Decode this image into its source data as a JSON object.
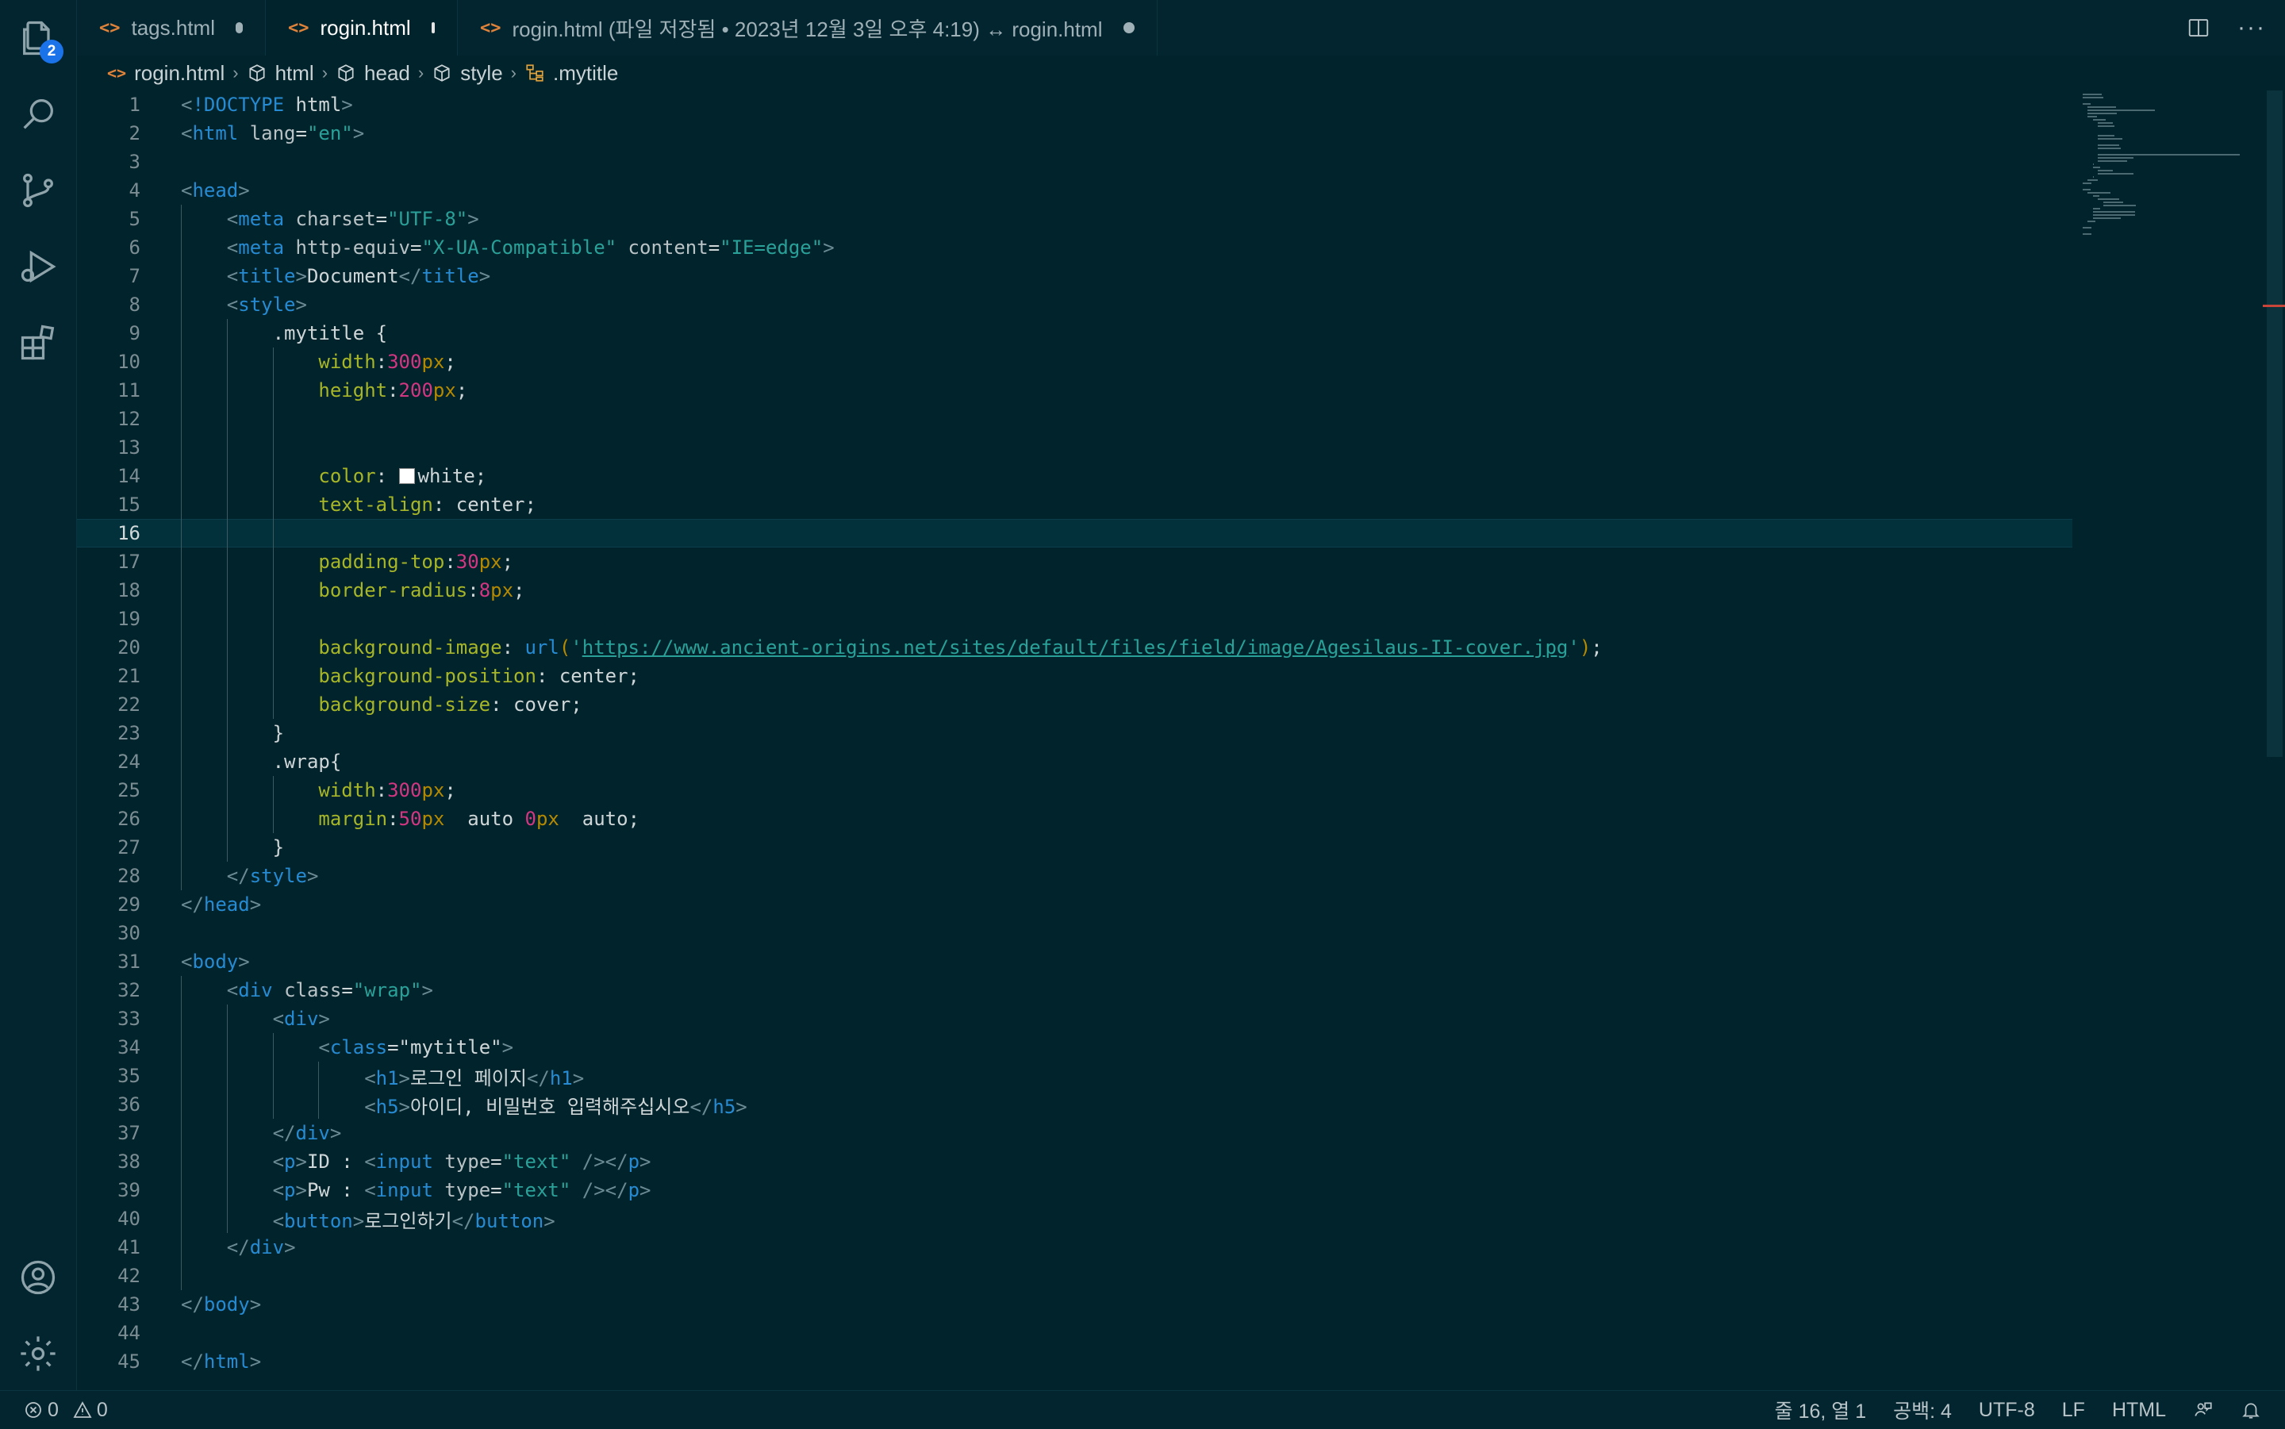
{
  "tabs": [
    {
      "label": "tags.html",
      "modified": true
    },
    {
      "label": "rogin.html",
      "modified": true,
      "active": true
    },
    {
      "label": "rogin.html (파일 저장됨 • 2023년 12월 3일 오후 4:19) ↔ rogin.html",
      "modified": true
    }
  ],
  "activity": {
    "explorer_badge": "2"
  },
  "breadcrumb": [
    {
      "label": "rogin.html",
      "icon": "html-file-icon"
    },
    {
      "label": "html",
      "icon": "cube-icon"
    },
    {
      "label": "head",
      "icon": "cube-icon"
    },
    {
      "label": "style",
      "icon": "cube-icon"
    },
    {
      "label": ".mytitle",
      "icon": "class-icon"
    }
  ],
  "editor": {
    "current_line": 16,
    "lines": [
      "<!DOCTYPE html>",
      "<html lang=\"en\">",
      "",
      "<head>",
      "    <meta charset=\"UTF-8\">",
      "    <meta http-equiv=\"X-UA-Compatible\" content=\"IE=edge\">",
      "    <title>Document</title>",
      "    <style>",
      "        .mytitle {",
      "            width:300px;",
      "            height:200px;",
      "",
      "",
      "            color: white;",
      "            text-align: center;",
      "",
      "            padding-top:30px;",
      "            border-radius:8px;",
      "",
      "            background-image: url('https://www.ancient-origins.net/sites/default/files/field/image/Agesilaus-II-cover.jpg');",
      "            background-position: center;",
      "            background-size: cover;",
      "        }",
      "        .wrap{",
      "            width:300px;",
      "            margin:50px  auto 0px  auto;",
      "        }",
      "    </style>",
      "</head>",
      "",
      "<body>",
      "    <div class=\"wrap\">",
      "        <div>",
      "            <class=\"mytitle\">",
      "                <h1>로그인 페이지</h1>",
      "                <h5>아이디, 비밀번호 입력해주십시오</h5>",
      "        </div>",
      "        <p>ID : <input type=\"text\" /></p>",
      "        <p>Pw : <input type=\"text\" /></p>",
      "        <button>로그인하기</button>",
      "    </div>",
      "",
      "</body>",
      "",
      "</html>"
    ]
  },
  "status": {
    "errors": "0",
    "warnings": "0",
    "position": "줄 16, 열 1",
    "spaces": "공백: 4",
    "encoding": "UTF-8",
    "eol": "LF",
    "language": "HTML"
  }
}
